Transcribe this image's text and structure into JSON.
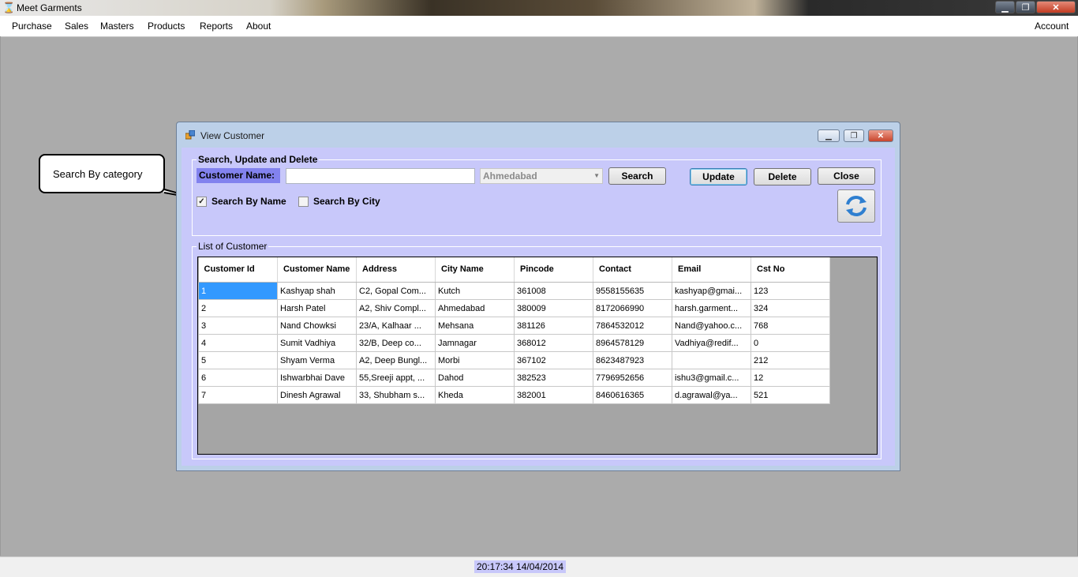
{
  "app": {
    "title": "Meet Garments"
  },
  "menu": {
    "items": [
      "Purchase",
      "Sales",
      "Masters",
      "Products",
      "Reports",
      "About"
    ],
    "right": "Account"
  },
  "callout": {
    "text": "Search By category"
  },
  "child_window": {
    "title": "View Customer",
    "search_group": {
      "title": "Search, Update and Delete",
      "customer_name_label": "Customer Name:",
      "customer_name_value": "",
      "city_selected": "Ahmedabad",
      "search_label": "Search",
      "update_label": "Update",
      "delete_label": "Delete",
      "close_label": "Close",
      "search_by_name_label": "Search By Name",
      "search_by_name_checked": true,
      "search_by_city_label": "Search By City",
      "search_by_city_checked": false
    },
    "list_group": {
      "title": "List of Customer",
      "columns": [
        "Customer Id",
        "Customer Name",
        "Address",
        "City Name",
        "Pincode",
        "Contact",
        "Email",
        "Cst No"
      ],
      "rows": [
        [
          "1",
          "Kashyap shah",
          "C2, Gopal Com...",
          "Kutch",
          "361008",
          "9558155635",
          "kashyap@gmai...",
          "123"
        ],
        [
          "2",
          "Harsh Patel",
          "A2, Shiv Compl...",
          "Ahmedabad",
          "380009",
          "8172066990",
          "harsh.garment...",
          "324"
        ],
        [
          "3",
          "Nand Chowksi",
          "23/A, Kalhaar ...",
          "Mehsana",
          "381126",
          "7864532012",
          "Nand@yahoo.c...",
          "768"
        ],
        [
          "4",
          "Sumit Vadhiya",
          "32/B, Deep co...",
          "Jamnagar",
          "368012",
          "8964578129",
          "Vadhiya@redif...",
          "0"
        ],
        [
          "5",
          "Shyam Verma",
          "A2, Deep Bungl...",
          "Morbi",
          "367102",
          "8623487923",
          "",
          "212"
        ],
        [
          "6",
          "Ishwarbhai Dave",
          "55,Sreeji appt, ...",
          "Dahod",
          "382523",
          "7796952656",
          "ishu3@gmail.c...",
          "12"
        ],
        [
          "7",
          "Dinesh Agrawal",
          "33, Shubham s...",
          "Kheda",
          "382001",
          "8460616365",
          "d.agrawal@ya...",
          "521"
        ]
      ]
    }
  },
  "status": {
    "datetime": "20:17:34 14/04/2014"
  },
  "colors": {
    "accent_label_bg": "#8282ee",
    "form_bg": "#c8c8fa",
    "mdi_bg": "#ababab",
    "selection": "#3399ff"
  }
}
